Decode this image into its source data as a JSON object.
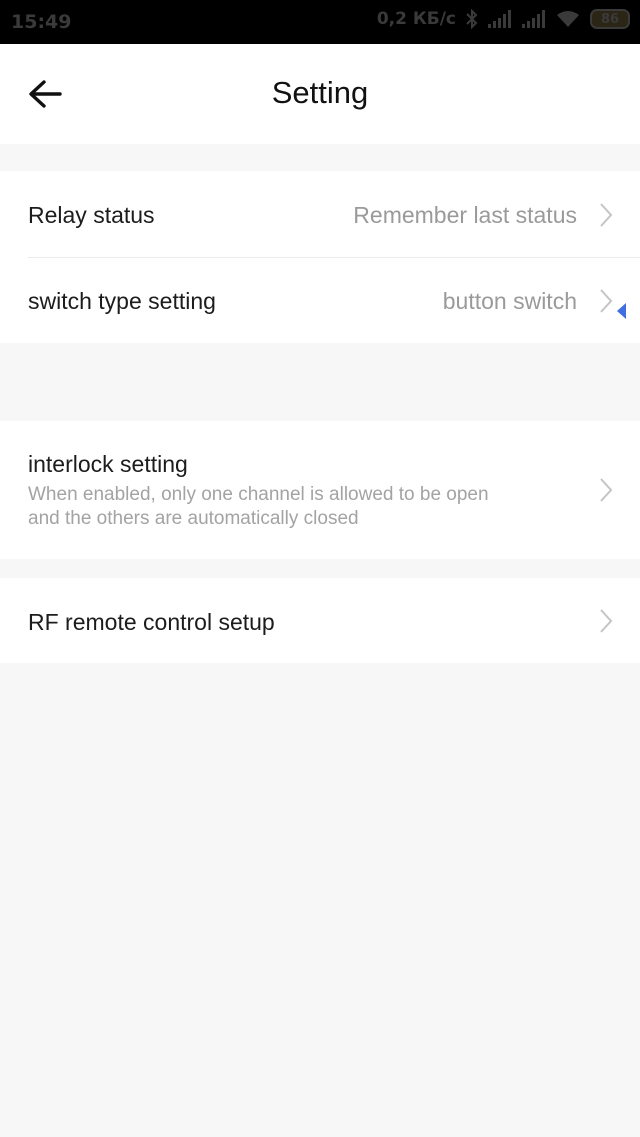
{
  "status_bar": {
    "time": "15:49",
    "net_speed": "0,2 КБ/с",
    "battery": "86",
    "icons": [
      "bluetooth-icon",
      "signal-icon",
      "signal-icon",
      "wifi-icon",
      "battery-icon"
    ]
  },
  "header": {
    "title": "Setting",
    "back_icon": "arrow-left-icon"
  },
  "settings": {
    "relay_status": {
      "label": "Relay status",
      "value": "Remember last status"
    },
    "switch_type": {
      "label": "switch type setting",
      "value": "button switch"
    },
    "interlock": {
      "label": "interlock setting",
      "description": "When enabled, only one channel is allowed to be open and the others are automatically closed"
    },
    "rf_remote": {
      "label": "RF remote control setup"
    }
  },
  "colors": {
    "background": "#f7f7f7",
    "card": "#ffffff",
    "primary_text": "#1c1c1c",
    "secondary_text": "#9a9a9a",
    "accent_marker": "#3f6fe0"
  }
}
